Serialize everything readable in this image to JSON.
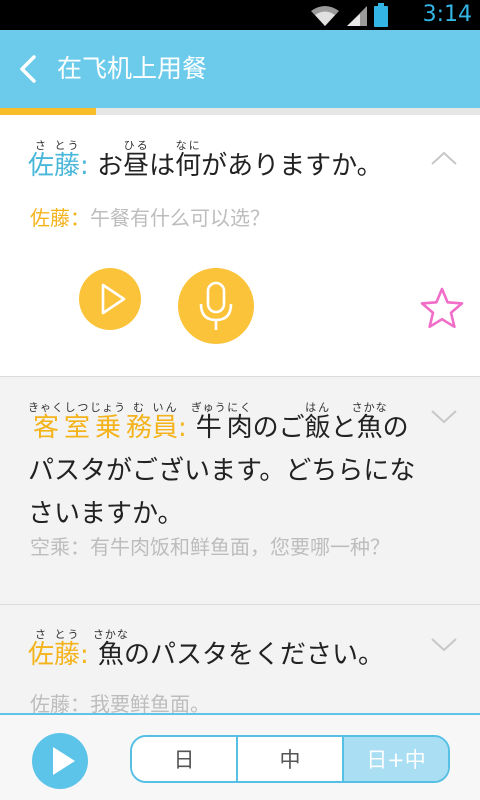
{
  "status_bar": {
    "time": "3:14",
    "icons": [
      "wifi-icon",
      "cell-signal-icon",
      "battery-icon"
    ]
  },
  "app_bar": {
    "back_icon": "chevron-left-icon",
    "title": "在飞机上用餐",
    "progress_fraction": 0.2
  },
  "colors": {
    "accent_blue": "#6ccbeb",
    "accent_yellow": "#f7be2a",
    "speaker_blue": "#49b7da",
    "speaker_yellow": "#f4b31b",
    "star_pink": "#f06ec8"
  },
  "dialogue": [
    {
      "state": "expanded",
      "chevron_icon": "chevron-up-icon",
      "speaker_jp": [
        {
          "base": "佐",
          "ruby": "さ"
        },
        {
          "base": "藤",
          "ruby": "とう"
        }
      ],
      "speaker_sep": ":",
      "jp_segments": [
        {
          "text": "お"
        },
        {
          "base": "昼",
          "ruby": "ひる"
        },
        {
          "text": "は"
        },
        {
          "base": "何",
          "ruby": "なに"
        },
        {
          "text": "がありますか。"
        }
      ],
      "zh_speaker": "佐藤：",
      "zh_text": "午餐有什么可以选？",
      "controls": {
        "play_icon": "play-icon",
        "mic_icon": "microphone-icon",
        "favorite_icon": "star-outline-icon"
      }
    },
    {
      "state": "collapsed",
      "chevron_icon": "chevron-down-icon",
      "speaker_jp": [
        {
          "base": "客",
          "ruby": "きゃく"
        },
        {
          "base": "室",
          "ruby": "しつ"
        },
        {
          "base": "乗",
          "ruby": "じょう"
        },
        {
          "base": "務",
          "ruby": "む"
        },
        {
          "base": "員",
          "ruby": "いん"
        }
      ],
      "speaker_sep": ":",
      "jp_segments": [
        {
          "base": "牛",
          "ruby": "ぎゅう"
        },
        {
          "base": "肉",
          "ruby": "にく"
        },
        {
          "text": "のご"
        },
        {
          "base": "飯",
          "ruby": "はん"
        },
        {
          "text": "と"
        },
        {
          "base": "魚",
          "ruby": "さかな"
        },
        {
          "text": "のパスタがございます。どちらになさいますか。"
        }
      ],
      "zh_speaker": "空乘：",
      "zh_text": "有牛肉饭和鲜鱼面，您要哪一种？"
    },
    {
      "state": "collapsed",
      "chevron_icon": "chevron-down-icon",
      "speaker_jp": [
        {
          "base": "佐",
          "ruby": "さ"
        },
        {
          "base": "藤",
          "ruby": "とう"
        }
      ],
      "speaker_sep": ":",
      "jp_segments": [
        {
          "base": "魚",
          "ruby": "さかな"
        },
        {
          "text": "のパスタをください。"
        }
      ],
      "zh_speaker": "佐藤：",
      "zh_text": "我要鲜鱼面。"
    }
  ],
  "bottom_bar": {
    "play_icon": "play-icon",
    "modes": [
      {
        "label": "日",
        "selected": false
      },
      {
        "label": "中",
        "selected": false
      },
      {
        "label": "日+中",
        "selected": true
      }
    ]
  }
}
